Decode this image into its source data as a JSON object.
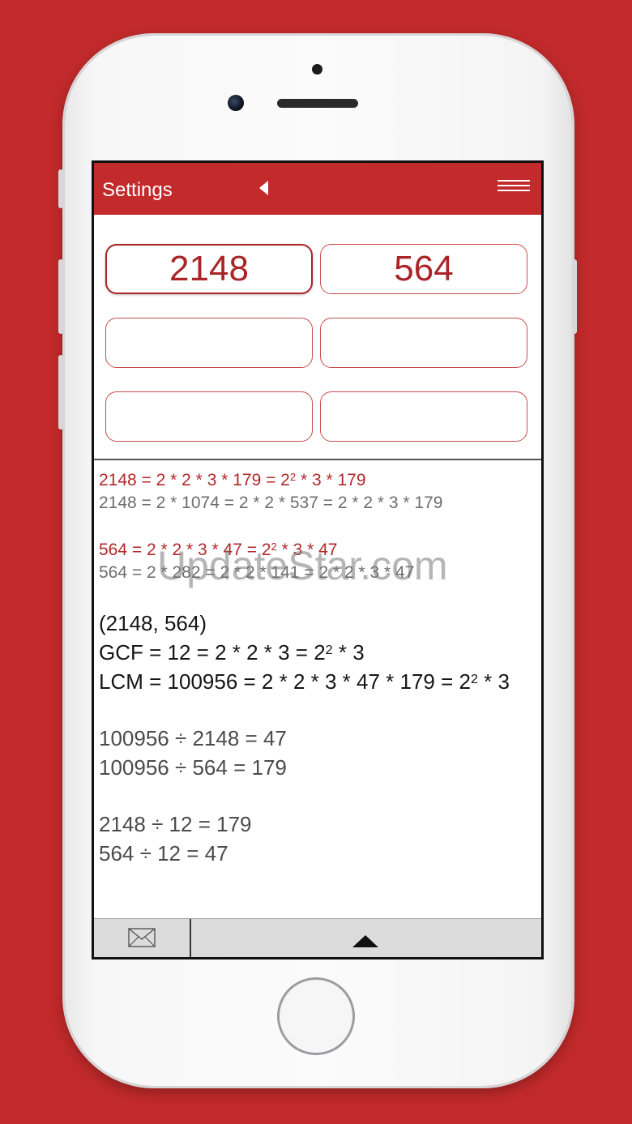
{
  "header": {
    "title": "Settings"
  },
  "inputs": [
    "2148",
    "564",
    "",
    "",
    "",
    ""
  ],
  "results": {
    "f1_red": {
      "pre": "2148 = 2 * 2 * 3 * 179 = 2",
      "exp": "2",
      "post": " * 3 * 179"
    },
    "f1_gray": "2148 = 2 * 1074 = 2 * 2 * 537 = 2 * 2 * 3 * 179",
    "f2_red": {
      "pre": "564 = 2 * 2 * 3 * 47 = 2",
      "exp": "2",
      "post": " * 3 * 47"
    },
    "f2_gray": "564 = 2 * 282 = 2 * 2 * 141 = 2 * 2 * 3 * 47",
    "pair": "(2148, 564)",
    "gcf": {
      "pre": "GCF = 12 = 2 * 2 * 3 = 2",
      "exp": "2",
      "post": " * 3"
    },
    "lcm": {
      "pre": "LCM = 100956 = 2 * 2 * 3 * 47 * 179 = 2",
      "exp": "2",
      "post": " * 3"
    },
    "div1": "100956 ÷ 2148 = 47",
    "div2": "100956 ÷ 564 = 179",
    "div3": "2148 ÷ 12 = 179",
    "div4": "564 ÷ 12 = 47"
  },
  "watermark": "UpdateStar.com",
  "icons": {
    "back": "back-arrow-icon",
    "menu": "hamburger-menu-icon",
    "mail": "mail-icon",
    "expand": "triangle-up-icon"
  },
  "colors": {
    "accent": "#c22a2b",
    "result_red": "#b2282a"
  }
}
